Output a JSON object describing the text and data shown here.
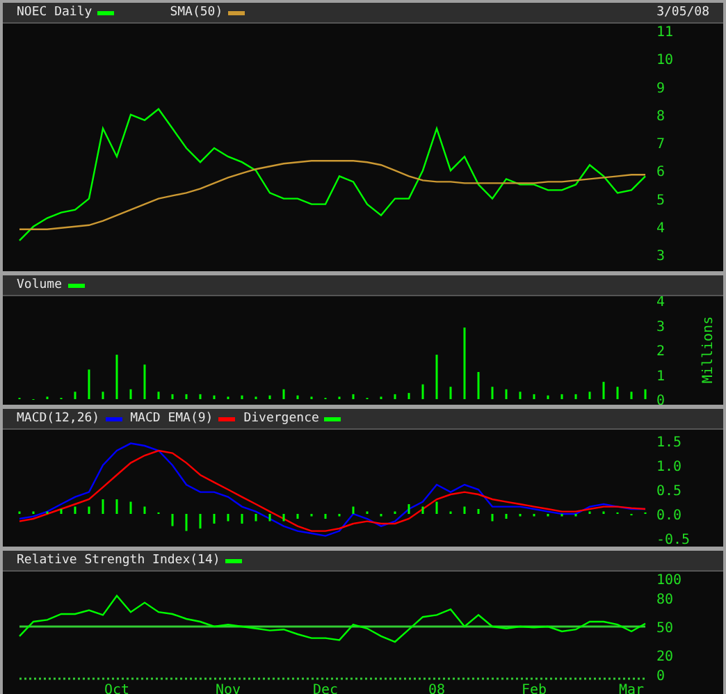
{
  "date": "3/05/08",
  "panels": [
    {
      "chart_data": {
        "type": "line",
        "ylim": [
          3,
          11
        ],
        "yticks": [
          3,
          4,
          5,
          6,
          7,
          8,
          9,
          10,
          11
        ],
        "series": [
          {
            "name": "NOEC Daily",
            "color": "#00ff00",
            "values": [
              3.5,
              4.0,
              4.3,
              4.5,
              4.6,
              5.0,
              7.5,
              6.5,
              8.0,
              7.8,
              8.2,
              7.5,
              6.8,
              6.3,
              6.8,
              6.5,
              6.3,
              6.0,
              5.2,
              5.0,
              5.0,
              4.8,
              4.8,
              5.8,
              5.6,
              4.8,
              4.4,
              5.0,
              5.0,
              6.0,
              7.5,
              6.0,
              6.5,
              5.5,
              5.0,
              5.7,
              5.5,
              5.5,
              5.3,
              5.3,
              5.5,
              6.2,
              5.8,
              5.2,
              5.3,
              5.8
            ]
          },
          {
            "name": "SMA(50)",
            "color": "#cc9933",
            "values": [
              3.9,
              3.9,
              3.9,
              3.95,
              4.0,
              4.05,
              4.2,
              4.4,
              4.6,
              4.8,
              5.0,
              5.1,
              5.2,
              5.35,
              5.55,
              5.75,
              5.9,
              6.05,
              6.15,
              6.25,
              6.3,
              6.35,
              6.35,
              6.35,
              6.35,
              6.3,
              6.2,
              6.0,
              5.8,
              5.65,
              5.6,
              5.6,
              5.55,
              5.55,
              5.55,
              5.55,
              5.55,
              5.55,
              5.6,
              5.6,
              5.65,
              5.7,
              5.75,
              5.8,
              5.85,
              5.85
            ]
          }
        ]
      }
    },
    {
      "chart_data": {
        "type": "bar",
        "ylabel": "Millions",
        "ylim": [
          0,
          4
        ],
        "yticks": [
          0,
          1,
          2,
          3,
          4
        ],
        "series": [
          {
            "name": "Volume",
            "color": "#00ff00",
            "values": [
              0.05,
              0,
              0.1,
              0.05,
              0.3,
              1.2,
              0.3,
              1.8,
              0.4,
              1.4,
              0.3,
              0.2,
              0.2,
              0.2,
              0.15,
              0.1,
              0.15,
              0.1,
              0.15,
              0.4,
              0.15,
              0.1,
              0.05,
              0.1,
              0.2,
              0.05,
              0.1,
              0.2,
              0.25,
              0.6,
              1.8,
              0.5,
              2.9,
              1.1,
              0.5,
              0.4,
              0.3,
              0.2,
              0.15,
              0.2,
              0.2,
              0.3,
              0.7,
              0.5,
              0.3,
              0.4
            ]
          }
        ]
      }
    },
    {
      "chart_data": {
        "type": "line",
        "ylim": [
          -0.5,
          1.5
        ],
        "yticks": [
          {
            "value": -0.5,
            "label": "-0.5"
          },
          {
            "value": 0,
            "label": "0.0"
          },
          {
            "value": 0.5,
            "label": "0.5"
          },
          {
            "value": 1,
            "label": "1.0"
          },
          {
            "value": 1.5,
            "label": "1.5"
          }
        ],
        "series": [
          {
            "name": "MACD(12,26)",
            "color": "#0000ff",
            "values": [
              -0.1,
              -0.05,
              0.05,
              0.2,
              0.35,
              0.45,
              1.0,
              1.3,
              1.45,
              1.4,
              1.3,
              1.0,
              0.6,
              0.45,
              0.45,
              0.35,
              0.15,
              0.05,
              -0.1,
              -0.25,
              -0.35,
              -0.4,
              -0.45,
              -0.35,
              0.0,
              -0.1,
              -0.25,
              -0.15,
              0.1,
              0.25,
              0.6,
              0.45,
              0.6,
              0.5,
              0.15,
              0.15,
              0.15,
              0.1,
              0.05,
              0.0,
              0.0,
              0.15,
              0.2,
              0.15,
              0.1,
              0.1
            ]
          },
          {
            "name": "MACD EMA(9)",
            "color": "#ff0000",
            "values": [
              -0.15,
              -0.1,
              0.0,
              0.1,
              0.2,
              0.3,
              0.55,
              0.8,
              1.05,
              1.2,
              1.3,
              1.25,
              1.05,
              0.8,
              0.65,
              0.5,
              0.35,
              0.2,
              0.05,
              -0.1,
              -0.25,
              -0.35,
              -0.35,
              -0.3,
              -0.2,
              -0.15,
              -0.2,
              -0.2,
              -0.1,
              0.1,
              0.3,
              0.4,
              0.45,
              0.4,
              0.3,
              0.25,
              0.2,
              0.15,
              0.1,
              0.05,
              0.05,
              0.1,
              0.15,
              0.15,
              0.12,
              0.1
            ]
          },
          {
            "name": "Divergence",
            "color": "#00ff00",
            "type": "bar",
            "values": [
              0.05,
              0.05,
              0.05,
              0.1,
              0.15,
              0.15,
              0.3,
              0.3,
              0.25,
              0.15,
              0.03,
              -0.25,
              -0.35,
              -0.3,
              -0.2,
              -0.15,
              -0.2,
              -0.15,
              -0.15,
              -0.15,
              -0.1,
              -0.05,
              -0.1,
              -0.05,
              0.15,
              0.05,
              -0.05,
              0.05,
              0.2,
              0.15,
              0.25,
              0.05,
              0.15,
              0.1,
              -0.15,
              -0.1,
              -0.05,
              -0.05,
              -0.05,
              -0.05,
              -0.05,
              0.05,
              0.05,
              0.03,
              -0.03,
              0.03
            ]
          }
        ]
      }
    },
    {
      "chart_data": {
        "type": "line",
        "categories": [
          null,
          null,
          null,
          null,
          null,
          null,
          null,
          "Oct",
          null,
          null,
          null,
          null,
          null,
          null,
          null,
          "Nov",
          null,
          null,
          null,
          null,
          null,
          null,
          "Dec",
          null,
          null,
          null,
          null,
          null,
          null,
          null,
          "08",
          null,
          null,
          null,
          null,
          null,
          null,
          "Feb",
          null,
          null,
          null,
          null,
          null,
          null,
          "Mar",
          null
        ],
        "ylim": [
          0,
          100
        ],
        "yticks": [
          0,
          20,
          50,
          80,
          100
        ],
        "ref_lines": [
          {
            "axis": "y",
            "value": 50
          }
        ],
        "series": [
          {
            "name": "Relative Strength Index(14)",
            "color": "#00ff00",
            "values": [
              40,
              55,
              57,
              63,
              63,
              67,
              62,
              82,
              65,
              75,
              65,
              63,
              58,
              55,
              50,
              52,
              50,
              48,
              46,
              47,
              42,
              38,
              38,
              36,
              52,
              48,
              40,
              34,
              47,
              60,
              62,
              68,
              50,
              62,
              50,
              48,
              50,
              49,
              50,
              45,
              47,
              55,
              55,
              52,
              45,
              53
            ]
          }
        ]
      }
    }
  ]
}
